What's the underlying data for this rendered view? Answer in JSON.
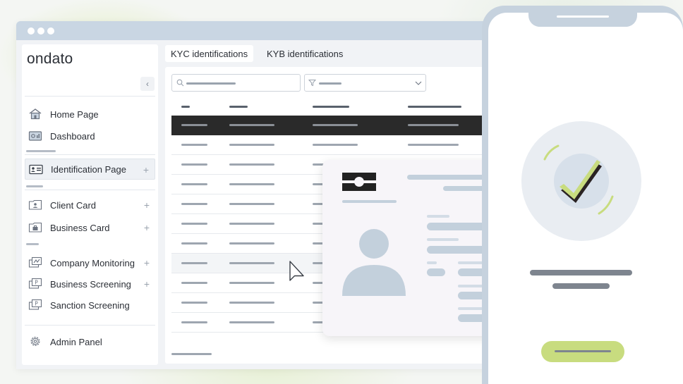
{
  "brand": {
    "logo_text": "ondato",
    "accent": "#c8dc7f",
    "dark_row": "#2a2a2a"
  },
  "sidebar": {
    "collapse_icon": "chevron-left-icon",
    "items": [
      {
        "label": "Home Page",
        "icon": "home-icon",
        "expandable": false
      },
      {
        "label": "Dashboard",
        "icon": "dashboard-icon",
        "expandable": false
      },
      {
        "label": "Identification Page",
        "icon": "id-card-icon",
        "expandable": true,
        "active": true
      },
      {
        "label": "Client Card",
        "icon": "client-card-icon",
        "expandable": true
      },
      {
        "label": "Business Card",
        "icon": "business-card-icon",
        "expandable": true
      },
      {
        "label": "Company Monitoring",
        "icon": "company-monitoring-icon",
        "expandable": true
      },
      {
        "label": "Business Screening",
        "icon": "business-screening-icon",
        "expandable": true
      },
      {
        "label": "Sanction Screening",
        "icon": "sanction-screening-icon",
        "expandable": false
      },
      {
        "label": "Admin Panel",
        "icon": "gear-icon",
        "expandable": false
      }
    ],
    "plus_symbol": "+"
  },
  "tabs": [
    {
      "label": "KYC identifications",
      "active": true
    },
    {
      "label": "KYB identifications",
      "active": false
    }
  ],
  "table": {
    "search_icon": "search-icon",
    "filter_icon": "filter-icon",
    "dropdown_icon": "chevron-down-icon",
    "row_count": 10
  },
  "phone": {
    "status": "success-check-icon"
  }
}
